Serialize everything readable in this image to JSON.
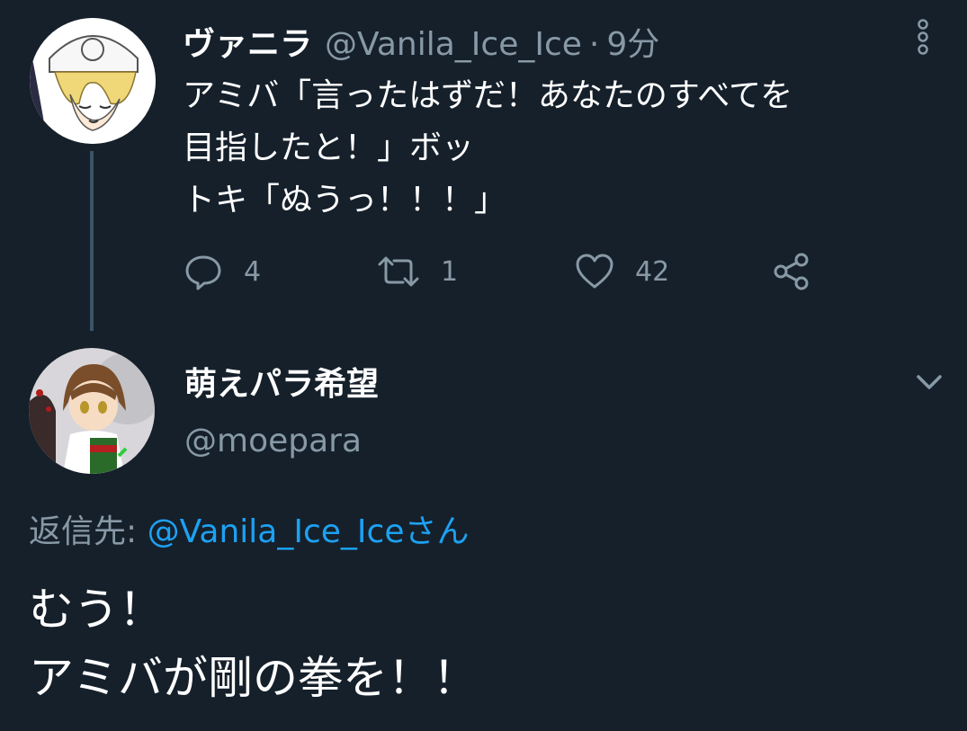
{
  "parent_tweet": {
    "display_name": "ヴァニラ",
    "handle": "@Vanila_Ice_Ice",
    "separator": "·",
    "time": "9分",
    "lines": [
      "アミバ「言ったはずだ！あなたのすべてを",
      "目指したと！」ボッ",
      "トキ「ぬうっ！！！」"
    ],
    "actions": {
      "reply_icon": "comment-icon",
      "reply_count": "4",
      "retweet_icon": "retweet-icon",
      "retweet_count": "1",
      "like_icon": "heart-icon",
      "like_count": "42",
      "share_icon": "share-icon"
    },
    "menu_icon": "more-vertical-icon"
  },
  "reply_tweet": {
    "display_name": "萌えパラ希望",
    "handle": "@moepara",
    "menu_icon": "chevron-down-icon",
    "reply_to_prefix": "返信先: ",
    "reply_to_handle": "@Vanila_Ice_Iceさん",
    "lines": [
      "むう！",
      "アミバが剛の拳を！！"
    ]
  },
  "colors": {
    "background": "#15202b",
    "primary_text": "#ffffff",
    "secondary_text": "#8899a6",
    "link": "#1da1f2",
    "thread_line": "#3d5466"
  }
}
